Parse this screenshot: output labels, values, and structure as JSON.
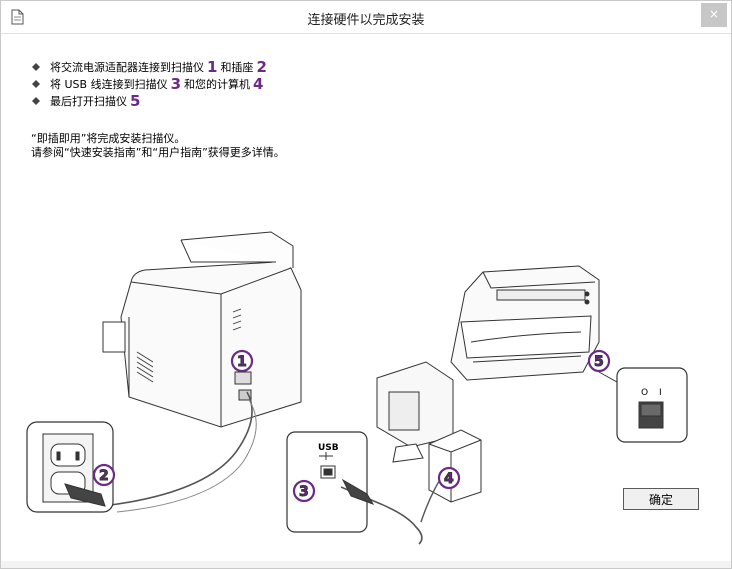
{
  "window": {
    "title": "连接硬件以完成安装",
    "close_label": "×"
  },
  "steps": [
    {
      "text_a": "将交流电源适配器连接到扫描仪",
      "num_a": "1",
      "text_b": "和插座",
      "num_b": "2"
    },
    {
      "text_a": "将 USB 线连接到扫描仪",
      "num_a": "3",
      "text_b": "和您的计算机",
      "num_b": "4"
    },
    {
      "text_a": "最后打开扫描仪",
      "num_a": "5"
    }
  ],
  "notes": {
    "line1": "“即插即用”将完成安装扫描仪。",
    "line2": "请参阅“快速安装指南”和“用户指南”获得更多详情。"
  },
  "illustration": {
    "badges": [
      "1",
      "2",
      "3",
      "4",
      "5"
    ],
    "usb_label": "USB",
    "switch_off_label": "O",
    "switch_on_label": "I"
  },
  "ok_button": {
    "label": "确定"
  },
  "colors": {
    "accent": "#6b2a85"
  }
}
